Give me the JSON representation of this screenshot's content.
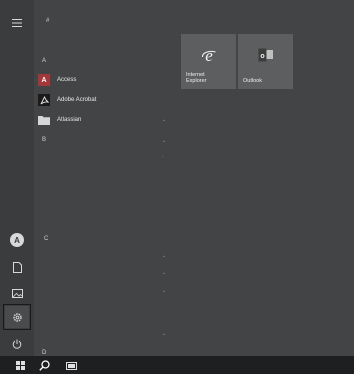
{
  "rail": {
    "items": [
      {
        "icon": "hamburger-menu-icon"
      },
      {
        "icon": "user-avatar-icon",
        "initial": "A"
      },
      {
        "icon": "documents-icon"
      },
      {
        "icon": "pictures-icon"
      },
      {
        "icon": "settings-icon",
        "selected": true
      },
      {
        "icon": "power-icon"
      }
    ]
  },
  "applist": {
    "headers": {
      "hash": "#",
      "a": "A",
      "b": "B",
      "c": "C",
      "d": "D"
    },
    "apps": [
      {
        "label": "Access",
        "icon": "access-app-icon",
        "icon_char": "A",
        "color": "#a4373a"
      },
      {
        "label": "Adobe Acrobat",
        "icon": "adobe-acrobat-icon",
        "icon_char": "",
        "color": "#1b1b1b"
      },
      {
        "label": "Atlassian",
        "icon": "folder-icon",
        "icon_char": "",
        "color": "#d6d6d6"
      }
    ]
  },
  "tiles": [
    {
      "label": "Internet\nExplorer",
      "icon": "internet-explorer-icon"
    },
    {
      "label": "Outlook",
      "icon": "outlook-icon"
    }
  ],
  "taskbar": {
    "items": [
      {
        "icon": "start-windows-icon"
      },
      {
        "icon": "search-icon"
      },
      {
        "icon": "task-view-icon"
      }
    ]
  }
}
